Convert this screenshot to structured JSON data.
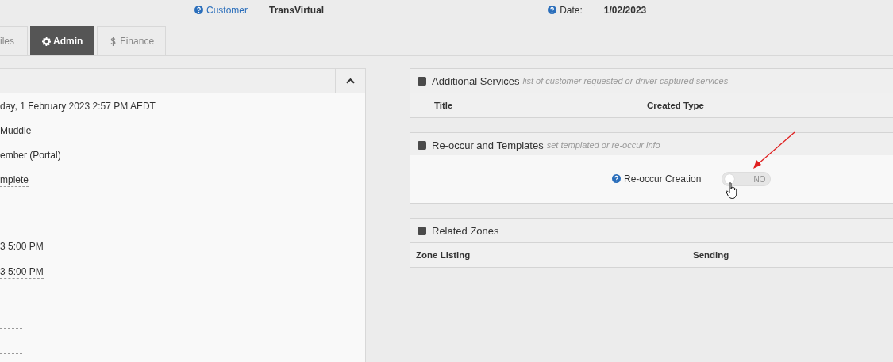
{
  "header": {
    "customer_label": "Customer",
    "customer_value": "TransVirtual",
    "date_label": "Date:",
    "date_value": "1/02/2023"
  },
  "tabs": [
    {
      "label": "iles",
      "kind": "plain",
      "selected": false
    },
    {
      "label": "Admin",
      "kind": "settings",
      "selected": true
    },
    {
      "label": "Finance",
      "kind": "money",
      "selected": false
    }
  ],
  "left_panel": {
    "expanded": true,
    "rows": [
      {
        "kind": "text",
        "value": "day, 1 February 2023 2:57 PM AEDT"
      },
      {
        "kind": "text",
        "value": "Muddle"
      },
      {
        "kind": "text",
        "value": "ember (Portal)"
      },
      {
        "kind": "editable",
        "value": "mplete"
      },
      {
        "kind": "editable"
      },
      {
        "kind": "blank"
      },
      {
        "kind": "editable",
        "value": "3 5:00 PM"
      },
      {
        "kind": "editable",
        "value": "3 5:00 PM"
      },
      {
        "kind": "editable"
      },
      {
        "kind": "editable"
      },
      {
        "kind": "editable"
      }
    ]
  },
  "panels": [
    {
      "kind": "table",
      "title": "Additional Services",
      "subtitle": "list of customer requested or driver captured services",
      "columns": [
        "Title",
        "Created Type"
      ]
    },
    {
      "kind": "toggle",
      "title": "Re-occur and Templates",
      "subtitle": "set templated or re-occur info",
      "field_label": "Re-occur Creation",
      "toggle_text": "NO",
      "on": false
    },
    {
      "kind": "table",
      "title": "Related Zones",
      "columns": [
        "Zone Listing",
        "Sending"
      ]
    }
  ]
}
